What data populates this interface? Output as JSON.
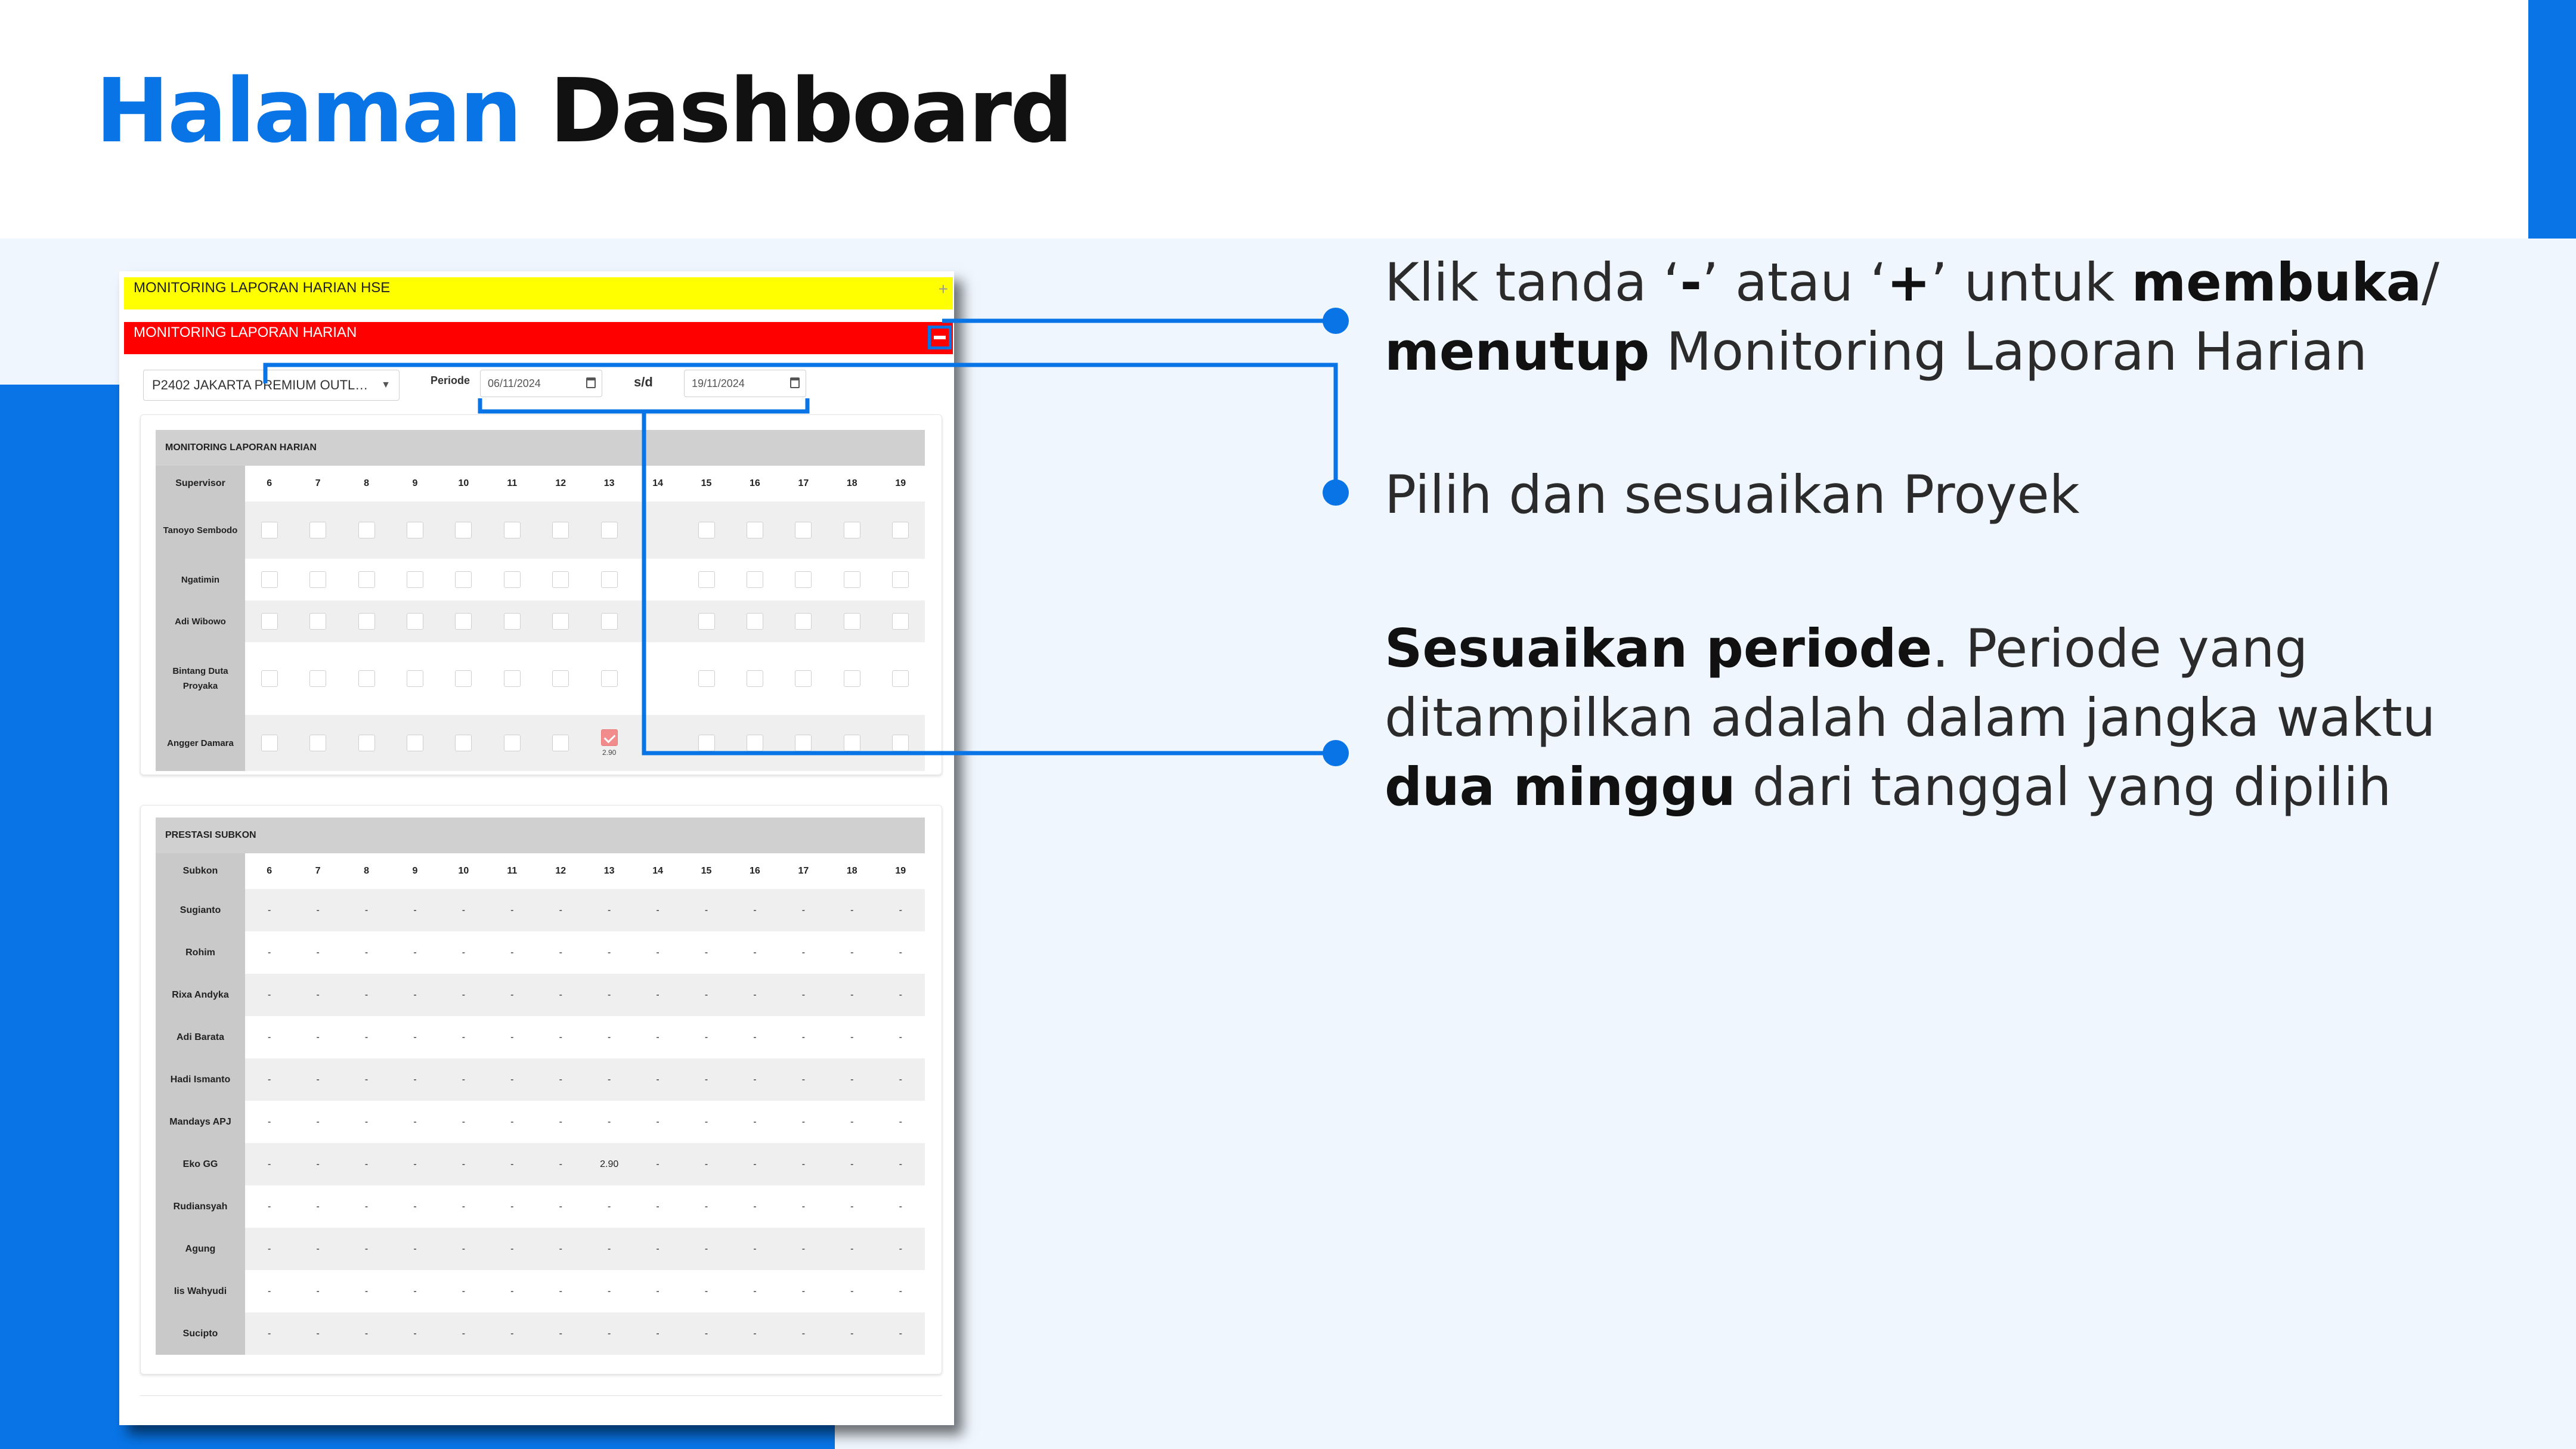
{
  "page_title": {
    "accent": "Halaman",
    "rest": "Dashboard"
  },
  "colors": {
    "accent": "#0874e6",
    "hse_bar": "#ffff00",
    "harian_bar": "#ff0000",
    "checked": "#f28c8c"
  },
  "app": {
    "hse_bar": {
      "label": "MONITORING LAPORAN HARIAN HSE",
      "toggle": "+"
    },
    "harian_bar": {
      "label": "MONITORING LAPORAN HARIAN",
      "toggle": "−"
    },
    "filters": {
      "project": "P2402 JAKARTA PREMIUM OUTL…",
      "periode_label": "Periode",
      "date_from": "06/11/2024",
      "sd_label": "s/d",
      "date_to": "19/11/2024"
    },
    "monitoring_table": {
      "title": "MONITORING LAPORAN HARIAN",
      "first_col": "Supervisor",
      "days": [
        "6",
        "7",
        "8",
        "9",
        "10",
        "11",
        "12",
        "13",
        "14",
        "15",
        "16",
        "17",
        "18",
        "19"
      ],
      "rows": [
        {
          "name": "Tanoyo Sembodo",
          "checked_day": null,
          "value": null
        },
        {
          "name": "Ngatimin",
          "checked_day": null,
          "value": null
        },
        {
          "name": "Adi Wibowo",
          "checked_day": null,
          "value": null
        },
        {
          "name": "Bintang Duta Proyaka",
          "checked_day": null,
          "value": null
        },
        {
          "name": "Angger Damara",
          "checked_day": "13",
          "value": "2.90"
        }
      ]
    },
    "prestasi_table": {
      "title": "PRESTASI SUBKON",
      "first_col": "Subkon",
      "days": [
        "6",
        "7",
        "8",
        "9",
        "10",
        "11",
        "12",
        "13",
        "14",
        "15",
        "16",
        "17",
        "18",
        "19"
      ],
      "empty_value": "-",
      "rows": [
        {
          "name": "Sugianto",
          "values": {}
        },
        {
          "name": "Rohim",
          "values": {}
        },
        {
          "name": "Rixa Andyka",
          "values": {}
        },
        {
          "name": "Adi Barata",
          "values": {}
        },
        {
          "name": "Hadi Ismanto",
          "values": {}
        },
        {
          "name": "Mandays APJ",
          "values": {}
        },
        {
          "name": "Eko GG",
          "values": {
            "13": "2.90"
          }
        },
        {
          "name": "Rudiansyah",
          "values": {}
        },
        {
          "name": "Agung",
          "values": {}
        },
        {
          "name": "Iis Wahyudi",
          "values": {}
        },
        {
          "name": "Sucipto",
          "values": {}
        }
      ]
    }
  },
  "callouts": {
    "c1": {
      "t1": "Klik tanda ‘",
      "b1": "-",
      "t2": "’ atau ‘",
      "b2": "+",
      "t3": "’ untuk ",
      "b3": "membuka",
      "t4": "/ ",
      "b4": "menutup",
      "t5": " Monitoring Laporan Harian"
    },
    "c2": {
      "t1": "Pilih dan sesuaikan Proyek"
    },
    "c3": {
      "b1": "Sesuaikan periode",
      "t1": ". Periode yang ditampilkan adalah dalam jangka waktu ",
      "b2": "dua minggu",
      "t2": " dari tanggal yang dipilih"
    }
  }
}
